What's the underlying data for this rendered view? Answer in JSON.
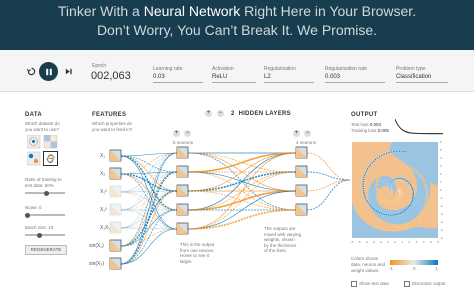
{
  "hero": {
    "line1_before": "Tinker With a ",
    "line1_bold": "Neural Network",
    "line1_after": " Right Here in Your Browser.",
    "line2": "Don’t Worry, You Can’t Break It. We Promise."
  },
  "controls": {
    "epoch_label": "Epoch",
    "epoch_value": "002,063",
    "learning_rate_label": "Learning rate",
    "learning_rate_value": "0.03",
    "activation_label": "Activation",
    "activation_value": "ReLU",
    "regularization_label": "Regularization",
    "regularization_value": "L2",
    "reg_rate_label": "Regularization rate",
    "reg_rate_value": "0.003",
    "problem_type_label": "Problem type",
    "problem_type_value": "Classification"
  },
  "data_panel": {
    "title": "DATA",
    "question_l1": "Which dataset do",
    "question_l2": "you want to use?",
    "ratio_l1": "Ratio of training to",
    "ratio_l2": "test data: ",
    "ratio_value": "50%",
    "noise_label": "Noise: ",
    "noise_value": "0",
    "batch_label": "Batch size: ",
    "batch_value": "10",
    "regenerate_label": "REGENERATE",
    "ratio_fraction": 0.5,
    "noise_fraction": 0.0,
    "batch_fraction": 0.33
  },
  "features_panel": {
    "title": "FEATURES",
    "question_l1": "Which properties do",
    "question_l2": "you want to feed in?",
    "features": [
      "X₁",
      "X₂",
      "X₁²",
      "X₂²",
      "X₁X₂",
      "sin(X₁)",
      "sin(X₂)"
    ]
  },
  "network": {
    "hidden_layers_count": "2",
    "hidden_layers_label": "HIDDEN LAYERS",
    "layer1_neurons": "5 neurons",
    "layer2_neurons": "4 neurons",
    "note_left_l1": "This is the output",
    "note_left_l2": "from one neuron.",
    "note_left_l3": "Hover to see it",
    "note_left_l4": "larger.",
    "note_right_l1": "The outputs are",
    "note_right_l2": "mixed with varying",
    "note_right_l3": "weights, shown",
    "note_right_l4": "by the thickness",
    "note_right_l5": "of the lines."
  },
  "output_panel": {
    "title": "OUTPUT",
    "test_loss_label": "Test loss ",
    "test_loss_value": "0.004",
    "training_loss_label": "Training loss ",
    "training_loss_value": "0.005",
    "axis_ticks": [
      "-6",
      "-5",
      "-4",
      "-3",
      "-2",
      "-1",
      "0",
      "1",
      "2",
      "3",
      "4",
      "5",
      "6"
    ],
    "legend_l1": "Colors shows",
    "legend_l2": "data, neuron and",
    "legend_l3": "weight values.",
    "legend_ticks": [
      "-1",
      "0",
      "1"
    ],
    "show_test_label": "Show test data",
    "discretize_label": "Discretize output"
  },
  "colors": {
    "header_bg": "#183d4e",
    "orange": "#f59322",
    "blue": "#0877bd",
    "play": "#183d4e"
  }
}
